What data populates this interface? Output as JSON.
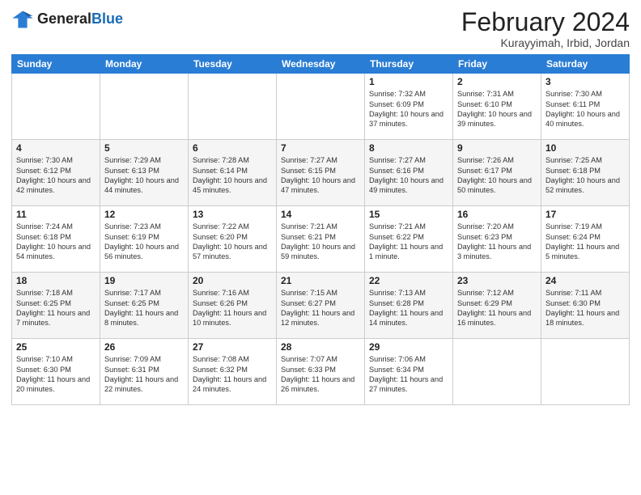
{
  "header": {
    "logo_general": "General",
    "logo_blue": "Blue",
    "month_year": "February 2024",
    "location": "Kurayyimah, Irbid, Jordan"
  },
  "days_of_week": [
    "Sunday",
    "Monday",
    "Tuesday",
    "Wednesday",
    "Thursday",
    "Friday",
    "Saturday"
  ],
  "weeks": [
    [
      {
        "day": "",
        "info": ""
      },
      {
        "day": "",
        "info": ""
      },
      {
        "day": "",
        "info": ""
      },
      {
        "day": "",
        "info": ""
      },
      {
        "day": "1",
        "info": "Sunrise: 7:32 AM\nSunset: 6:09 PM\nDaylight: 10 hours\nand 37 minutes."
      },
      {
        "day": "2",
        "info": "Sunrise: 7:31 AM\nSunset: 6:10 PM\nDaylight: 10 hours\nand 39 minutes."
      },
      {
        "day": "3",
        "info": "Sunrise: 7:30 AM\nSunset: 6:11 PM\nDaylight: 10 hours\nand 40 minutes."
      }
    ],
    [
      {
        "day": "4",
        "info": "Sunrise: 7:30 AM\nSunset: 6:12 PM\nDaylight: 10 hours\nand 42 minutes."
      },
      {
        "day": "5",
        "info": "Sunrise: 7:29 AM\nSunset: 6:13 PM\nDaylight: 10 hours\nand 44 minutes."
      },
      {
        "day": "6",
        "info": "Sunrise: 7:28 AM\nSunset: 6:14 PM\nDaylight: 10 hours\nand 45 minutes."
      },
      {
        "day": "7",
        "info": "Sunrise: 7:27 AM\nSunset: 6:15 PM\nDaylight: 10 hours\nand 47 minutes."
      },
      {
        "day": "8",
        "info": "Sunrise: 7:27 AM\nSunset: 6:16 PM\nDaylight: 10 hours\nand 49 minutes."
      },
      {
        "day": "9",
        "info": "Sunrise: 7:26 AM\nSunset: 6:17 PM\nDaylight: 10 hours\nand 50 minutes."
      },
      {
        "day": "10",
        "info": "Sunrise: 7:25 AM\nSunset: 6:18 PM\nDaylight: 10 hours\nand 52 minutes."
      }
    ],
    [
      {
        "day": "11",
        "info": "Sunrise: 7:24 AM\nSunset: 6:18 PM\nDaylight: 10 hours\nand 54 minutes."
      },
      {
        "day": "12",
        "info": "Sunrise: 7:23 AM\nSunset: 6:19 PM\nDaylight: 10 hours\nand 56 minutes."
      },
      {
        "day": "13",
        "info": "Sunrise: 7:22 AM\nSunset: 6:20 PM\nDaylight: 10 hours\nand 57 minutes."
      },
      {
        "day": "14",
        "info": "Sunrise: 7:21 AM\nSunset: 6:21 PM\nDaylight: 10 hours\nand 59 minutes."
      },
      {
        "day": "15",
        "info": "Sunrise: 7:21 AM\nSunset: 6:22 PM\nDaylight: 11 hours\nand 1 minute."
      },
      {
        "day": "16",
        "info": "Sunrise: 7:20 AM\nSunset: 6:23 PM\nDaylight: 11 hours\nand 3 minutes."
      },
      {
        "day": "17",
        "info": "Sunrise: 7:19 AM\nSunset: 6:24 PM\nDaylight: 11 hours\nand 5 minutes."
      }
    ],
    [
      {
        "day": "18",
        "info": "Sunrise: 7:18 AM\nSunset: 6:25 PM\nDaylight: 11 hours\nand 7 minutes."
      },
      {
        "day": "19",
        "info": "Sunrise: 7:17 AM\nSunset: 6:25 PM\nDaylight: 11 hours\nand 8 minutes."
      },
      {
        "day": "20",
        "info": "Sunrise: 7:16 AM\nSunset: 6:26 PM\nDaylight: 11 hours\nand 10 minutes."
      },
      {
        "day": "21",
        "info": "Sunrise: 7:15 AM\nSunset: 6:27 PM\nDaylight: 11 hours\nand 12 minutes."
      },
      {
        "day": "22",
        "info": "Sunrise: 7:13 AM\nSunset: 6:28 PM\nDaylight: 11 hours\nand 14 minutes."
      },
      {
        "day": "23",
        "info": "Sunrise: 7:12 AM\nSunset: 6:29 PM\nDaylight: 11 hours\nand 16 minutes."
      },
      {
        "day": "24",
        "info": "Sunrise: 7:11 AM\nSunset: 6:30 PM\nDaylight: 11 hours\nand 18 minutes."
      }
    ],
    [
      {
        "day": "25",
        "info": "Sunrise: 7:10 AM\nSunset: 6:30 PM\nDaylight: 11 hours\nand 20 minutes."
      },
      {
        "day": "26",
        "info": "Sunrise: 7:09 AM\nSunset: 6:31 PM\nDaylight: 11 hours\nand 22 minutes."
      },
      {
        "day": "27",
        "info": "Sunrise: 7:08 AM\nSunset: 6:32 PM\nDaylight: 11 hours\nand 24 minutes."
      },
      {
        "day": "28",
        "info": "Sunrise: 7:07 AM\nSunset: 6:33 PM\nDaylight: 11 hours\nand 26 minutes."
      },
      {
        "day": "29",
        "info": "Sunrise: 7:06 AM\nSunset: 6:34 PM\nDaylight: 11 hours\nand 27 minutes."
      },
      {
        "day": "",
        "info": ""
      },
      {
        "day": "",
        "info": ""
      }
    ]
  ]
}
